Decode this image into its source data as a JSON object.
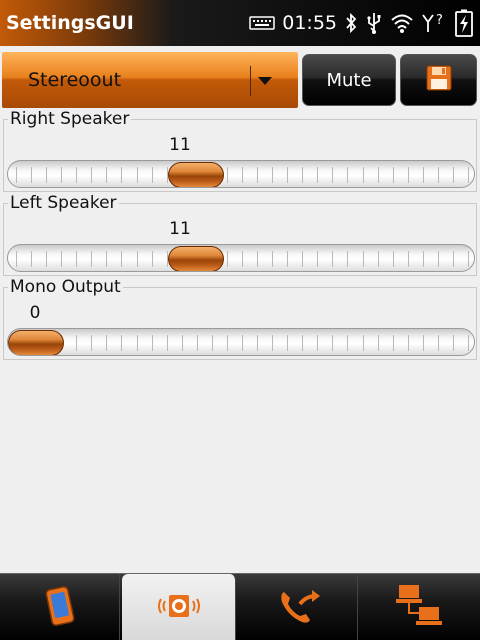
{
  "app": {
    "title": "SettingsGUI"
  },
  "status": {
    "time": "01:55",
    "icons": [
      "keyboard-icon",
      "bluetooth-icon",
      "usb-icon",
      "wifi-icon",
      "signal-unknown-icon",
      "battery-charging-icon"
    ]
  },
  "toolbar": {
    "output_select": "Stereoout",
    "mute_label": "Mute",
    "save_icon": "floppy-save-icon"
  },
  "sliders": [
    {
      "label": "Right Speaker",
      "value": "11",
      "fraction": 0.39
    },
    {
      "label": "Left Speaker",
      "value": "11",
      "fraction": 0.39
    },
    {
      "label": "Mono Output",
      "value": "0",
      "fraction": 0.0
    }
  ],
  "bottom_tabs": [
    {
      "name": "device-tab",
      "icon": "phone-device-icon",
      "active": false
    },
    {
      "name": "audio-tab",
      "icon": "speaker-audio-icon",
      "active": true
    },
    {
      "name": "call-tab",
      "icon": "phone-call-icon",
      "active": false
    },
    {
      "name": "network-tab",
      "icon": "network-computers-icon",
      "active": false
    }
  ],
  "colors": {
    "accent": "#e0802a",
    "dark": "#000000",
    "background": "#efefef"
  }
}
